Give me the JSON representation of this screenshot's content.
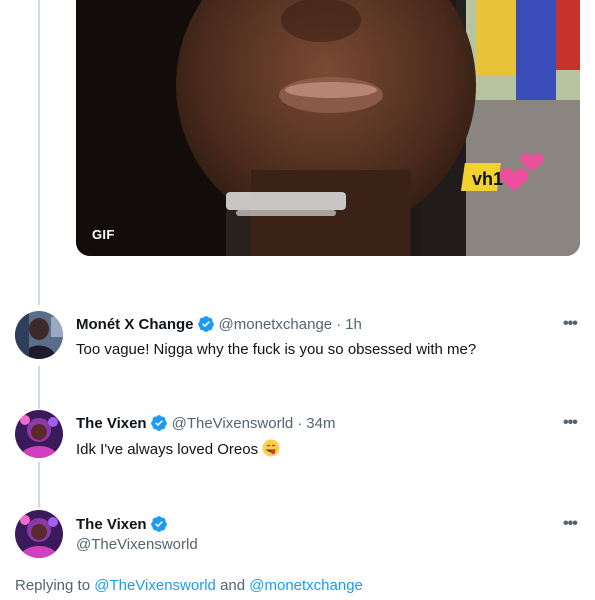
{
  "media": {
    "badge": "GIF",
    "watermark": "vh1"
  },
  "tweets": [
    {
      "display_name": "Monét X Change",
      "handle": "@monetxchange",
      "time": "1h",
      "text": "Too vague! Nigga why the fuck is you so obsessed with me?",
      "more": "•••"
    },
    {
      "display_name": "The Vixen",
      "handle": "@TheVixensworld",
      "time": "34m",
      "text": "Idk I've always loved Oreos",
      "emoji": "face-savoring-food",
      "more": "•••"
    },
    {
      "display_name": "The Vixen",
      "handle": "@TheVixensworld",
      "more": "•••"
    }
  ],
  "replying": {
    "prefix": "Replying to",
    "mention_1": "@TheVixensworld",
    "conjunction": "and",
    "mention_2": "@monetxchange"
  },
  "colors": {
    "verified": "#1d9bf0",
    "link": "#1d9bf0",
    "secondary_text": "#536471",
    "thread_line": "#cfd9de"
  }
}
